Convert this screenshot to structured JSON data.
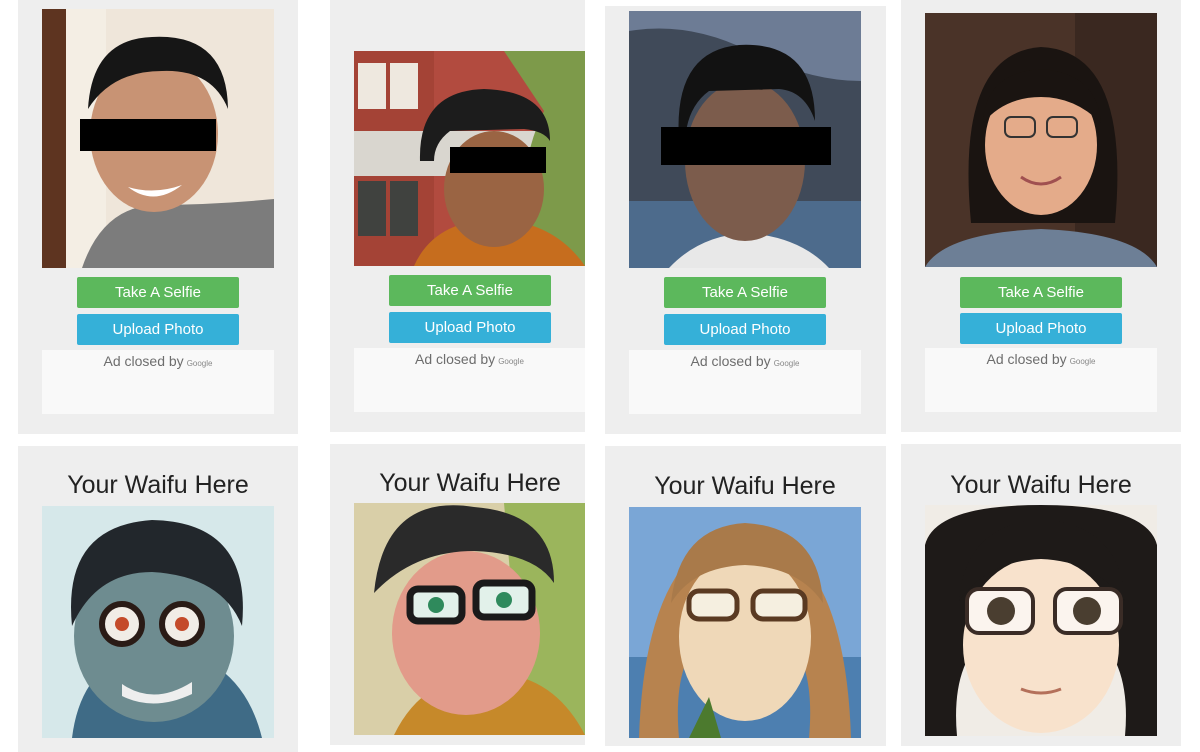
{
  "cards": [
    {
      "buttons": {
        "selfie": "Take A Selfie",
        "upload": "Upload Photo"
      },
      "ad": {
        "text": "Ad closed by",
        "brand": "Google"
      },
      "result_title": "Your Waifu Here",
      "colors": {
        "bg": "#efe6da",
        "skin": "#c89374",
        "hair": "#161616",
        "shirt": "#7c7c7c"
      }
    },
    {
      "buttons": {
        "selfie": "Take A Selfie",
        "upload": "Upload Photo"
      },
      "ad": {
        "text": "Ad closed by",
        "brand": "Google"
      },
      "result_title": "Your Waifu Here",
      "colors": {
        "bg": "#b24b3f",
        "skin": "#9a6443",
        "hair": "#1c1c1c",
        "shirt": "#c66d1e"
      }
    },
    {
      "buttons": {
        "selfie": "Take A Selfie",
        "upload": "Upload Photo"
      },
      "ad": {
        "text": "Ad closed by",
        "brand": "Google"
      },
      "result_title": "Your Waifu Here",
      "colors": {
        "bg": "#6d7c95",
        "skin": "#7c5c4c",
        "hair": "#121212",
        "shirt": "#e8e8e8"
      }
    },
    {
      "buttons": {
        "selfie": "Take A Selfie",
        "upload": "Upload Photo"
      },
      "ad": {
        "text": "Ad closed by",
        "brand": "Google"
      },
      "result_title": "Your Waifu Here",
      "colors": {
        "bg": "#4a3328",
        "skin": "#e4ab8a",
        "hair": "#1a1411",
        "shirt": "#6d7f96"
      }
    }
  ]
}
